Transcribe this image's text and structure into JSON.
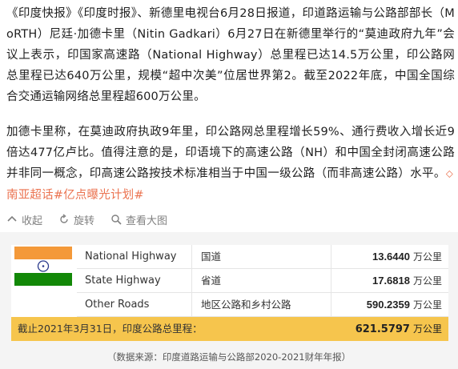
{
  "post": {
    "para1_a": "《印度快报》《印度时报》、新德里电视台6月28日报道，印道路运输与公路部部长（MoRTH）尼廷·加德卡里（Nitin Gadkari）6月27日在新德里举行的“莫迪政府九年”会议上表示，印国家高速路（National Highway）总里程已达14.5万公里，印公路网总里程已达640万公里，规模“超中次美”位居世界第2。截至2022年底，中国全国综合交通运输网络总里程超600万公里。",
    "para2_a": "加德卡里称，在莫迪政府执政9年里，印公路网总里程增长59%、通行费收入增长近9倍达477亿卢比。值得注意的是，印语境下的高速公路（NH）和中国全封闭高速公路并非同一概念，印高速公路按技术标准相当于中国一级公路（而非高速公路）水平。",
    "topic_1": "南亚超话",
    "topic_2": "#亿点曝光计划#"
  },
  "toolbar": {
    "collapse_label": "收起",
    "rotate_label": "旋转",
    "view_original_label": "查看大图"
  },
  "image": {
    "rows": [
      {
        "name": "National Highway",
        "cn": "国道",
        "value": "13.6440",
        "unit": "万公里"
      },
      {
        "name": "State Highway",
        "cn": "省道",
        "value": "17.6818",
        "unit": "万公里"
      },
      {
        "name": "Other Roads",
        "cn": "地区公路和乡村公路",
        "value": "590.2359",
        "unit": "万公里"
      }
    ],
    "total_label": "截止2021年3月31日，印度公路总里程：",
    "total_value": "621.5797",
    "total_unit": "万公里",
    "source": "（数据来源：印度道路运输与公路部2020-2021财年年报）"
  },
  "colors": {
    "topic": "#eb7350",
    "total_bar": "#f6c54d",
    "flag_saffron": "#f49939",
    "flag_green": "#128807",
    "flag_chakra": "#2b3a8c"
  }
}
